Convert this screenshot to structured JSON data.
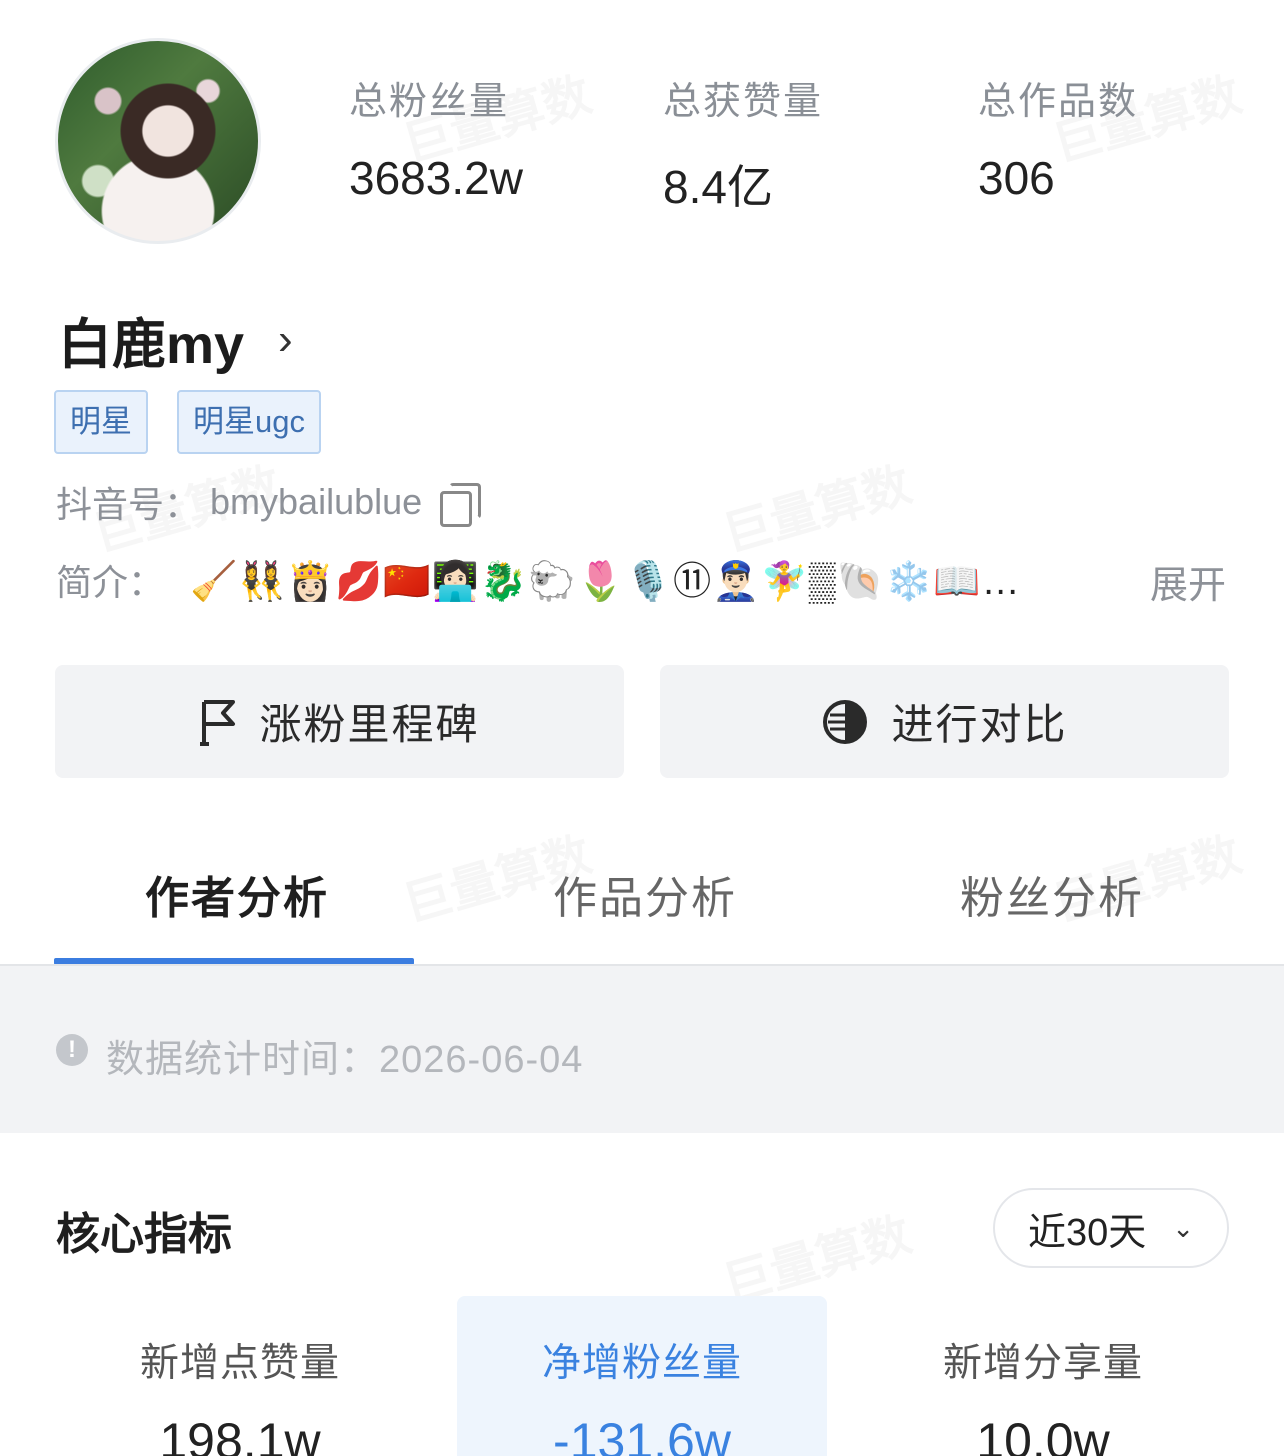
{
  "stats": [
    {
      "label": "总粉丝量",
      "value": "3683.2w"
    },
    {
      "label": "总获赞量",
      "value": "8.4亿"
    },
    {
      "label": "总作品数",
      "value": "306"
    }
  ],
  "profile": {
    "name": "白鹿my",
    "tags": [
      "明星",
      "明星ugc"
    ],
    "douyin_label": "抖音号：",
    "douyin_id": "bmybailublue",
    "bio_label": "简介：",
    "bio_emojis": "🧹👯‍♀️👸🏻💋🇨🇳👩🏻‍💻🐉🐑🌷🎙️⑪👮🏻‍♂️🧚‍♀️▒🐚❄️📖…",
    "expand": "展开"
  },
  "actions": {
    "milestone": "涨粉里程碑",
    "compare": "进行对比"
  },
  "tabs": [
    "作者分析",
    "作品分析",
    "粉丝分析"
  ],
  "notice": {
    "text": "数据统计时间：2026-06-04"
  },
  "core": {
    "title": "核心指标",
    "range": "近30天",
    "metrics": [
      {
        "label": "新增点赞量",
        "value": "198.1w"
      },
      {
        "label": "净增粉丝量",
        "value": "-131.6w"
      },
      {
        "label": "新增分享量",
        "value": "10.0w"
      }
    ]
  },
  "watermark": "巨量算数",
  "colors": {
    "accent": "#3b7de0",
    "tag_text": "#3d6fb0",
    "tag_bg": "#eaf2fc"
  }
}
